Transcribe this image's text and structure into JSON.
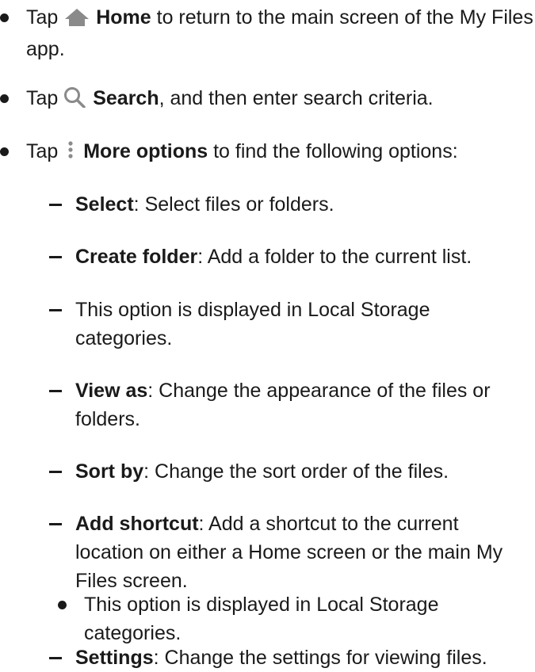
{
  "items": [
    {
      "id": "home",
      "pre": "Tap ",
      "icon": "home-icon",
      "bold": "Home",
      "post": " to return to the main screen of the My Files app."
    },
    {
      "id": "search",
      "pre": "Tap ",
      "icon": "search-icon",
      "bold": "Search",
      "post": ", and then enter search criteria."
    },
    {
      "id": "more",
      "pre": "Tap ",
      "icon": "more-options-icon",
      "bold": "More options",
      "post": " to find the following options:"
    }
  ],
  "options": [
    {
      "bold": "Select",
      "post": ": Select files or folders."
    },
    {
      "bold": "Create folder",
      "post": ": Add a folder to the current list."
    },
    {
      "bold": "",
      "post": "This option is displayed in Local Storage categories."
    },
    {
      "bold": "View as",
      "post": ": Change the appearance of the files or folders."
    },
    {
      "bold": "Sort by",
      "post": ": Change the sort order of the files."
    },
    {
      "bold": "Add shortcut",
      "post": ": Add a shortcut to the current location on either a Home screen or the main My Files screen."
    }
  ],
  "sub_note": "This option is displayed in Local Storage categories.",
  "last_option": {
    "bold": "Settings",
    "post": ": Change the settings for viewing files."
  },
  "colors": {
    "text": "#1a1a1a",
    "icon": "#8a8a8a"
  }
}
